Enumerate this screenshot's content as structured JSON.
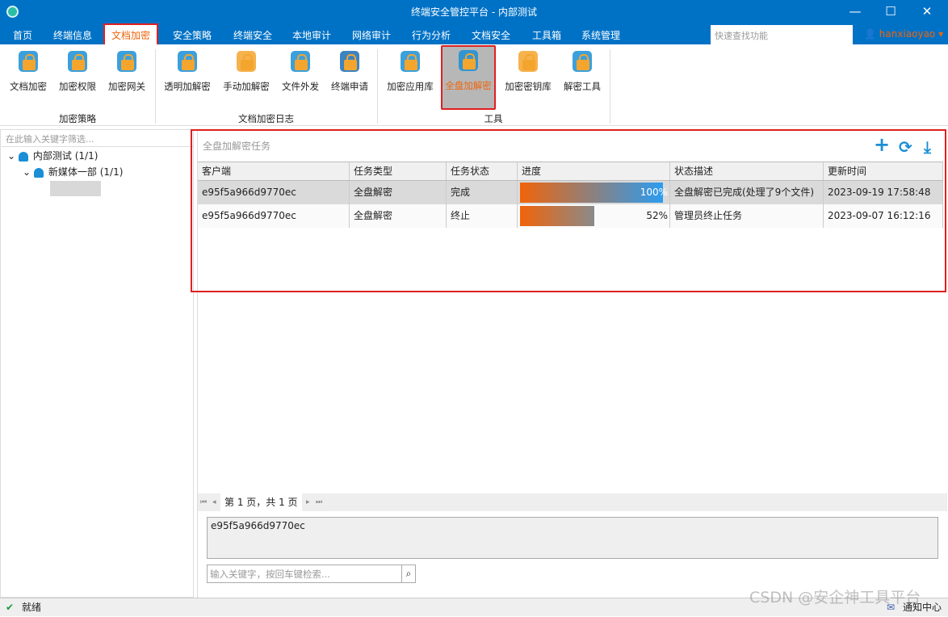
{
  "window": {
    "title": "终端安全管控平台 - 内部测试",
    "minimize": "—",
    "maximize": "☐",
    "close": "✕"
  },
  "menu": {
    "tabs": [
      "首页",
      "终端信息",
      "文档加密",
      "安全策略",
      "终端安全",
      "本地审计",
      "网络审计",
      "行为分析",
      "文档安全",
      "工具箱",
      "系统管理"
    ],
    "active": "文档加密",
    "quick_search_placeholder": "快速查找功能",
    "user": "hanxiaoyao ▾"
  },
  "ribbon": {
    "groups": [
      {
        "label": "加密策略",
        "buttons": [
          "文档加密",
          "加密权限",
          "加密网关"
        ]
      },
      {
        "label": "文档加密日志",
        "buttons": [
          "透明加解密",
          "手动加解密",
          "文件外发",
          "终端申请"
        ]
      },
      {
        "label": "工具",
        "buttons": [
          "加密应用库",
          "全盘加解密",
          "加密密钥库",
          "解密工具"
        ]
      }
    ],
    "selected": "全盘加解密"
  },
  "sidebar": {
    "filter_placeholder": "在此输入关键字筛选...",
    "tree": [
      {
        "label": "内部测试 (1/1)"
      },
      {
        "label": "新媒体一部 (1/1)"
      }
    ]
  },
  "panel": {
    "title": "全盘加解密任务",
    "tools": {
      "add": "+",
      "refresh": "⟳",
      "download": "⤓"
    },
    "columns": [
      "客户端",
      "任务类型",
      "任务状态",
      "进度",
      "状态描述",
      "更新时间"
    ],
    "rows": [
      {
        "client": "e95f5a966d9770ec",
        "type": "全盘解密",
        "status": "完成",
        "progress": 100,
        "progress_label": "100%",
        "desc": "全盘解密已完成(处理了9个文件)",
        "time": "2023-09-19 17:58:48"
      },
      {
        "client": "e95f5a966d9770ec",
        "type": "全盘解密",
        "status": "终止",
        "progress": 52,
        "progress_label": "52%",
        "desc": "管理员终止任务",
        "time": "2023-09-07 16:12:16"
      }
    ],
    "pager": {
      "first": "⏮",
      "prev": "◂",
      "text": "第 1 页，共 1 页",
      "next": "▸",
      "last": "⏭"
    },
    "detail_text": "e95f5a966d9770ec",
    "search_placeholder": "输入关键字，按回车键检索..."
  },
  "status": {
    "text": "就绪",
    "notify": "通知中心",
    "watermark": "CSDN @安企神工具平台"
  },
  "colors": {
    "accent": "#0072c6",
    "highlight": "#f0640a",
    "selection_border": "#e02020"
  }
}
